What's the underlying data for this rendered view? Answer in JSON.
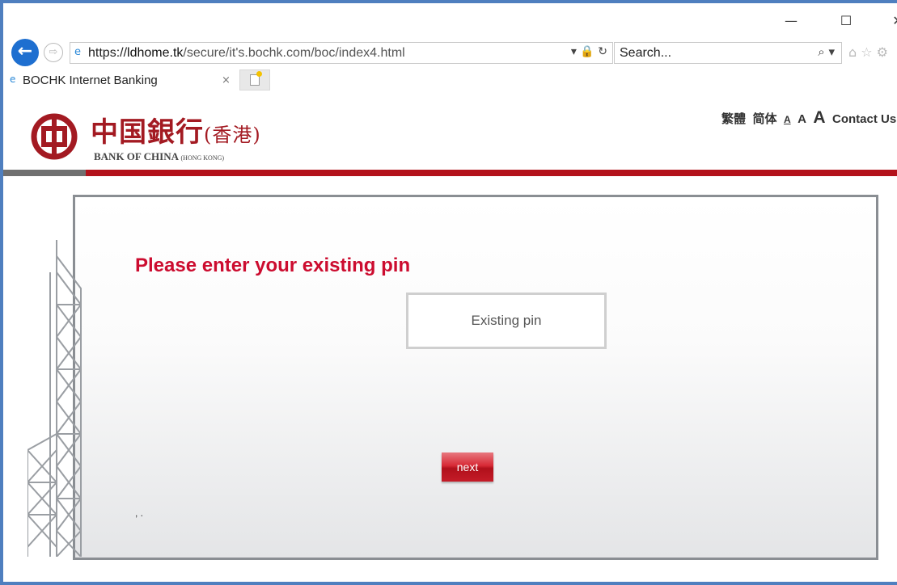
{
  "window": {
    "minimize_glyph": "—",
    "maximize_glyph": "☐",
    "close_glyph": "✕"
  },
  "browser": {
    "back_glyph": "←",
    "forward_glyph": "⇨",
    "address": {
      "protocol": "https://",
      "host": "ldhome.tk",
      "path": "/secure/it's.bochk.com/boc/index4.html",
      "tools": "▾ 🔒 ↻"
    },
    "search": {
      "placeholder": "Search...",
      "icon": "search-icon"
    },
    "toolbar_icons": "⌂ ☆ ⚙",
    "tab": {
      "title": "BOCHK Internet Banking",
      "close_glyph": "×"
    },
    "accent_color": "#4f7fbf"
  },
  "site": {
    "logo": {
      "chinese_name": "中国銀行",
      "chinese_region": "(香港)",
      "english_name": "BANK OF CHINA",
      "english_region": "(HONG KONG)"
    },
    "tools": {
      "traditional": "繁體",
      "simplified": "简体",
      "font_small": "A",
      "font_medium": "A",
      "font_large": "A",
      "contact": "Contact Us"
    },
    "brand_color": "#b3121b",
    "heading": "Please enter your existing pin",
    "pin_placeholder": "Existing pin",
    "next_label": "next",
    "footnote": ", ."
  }
}
